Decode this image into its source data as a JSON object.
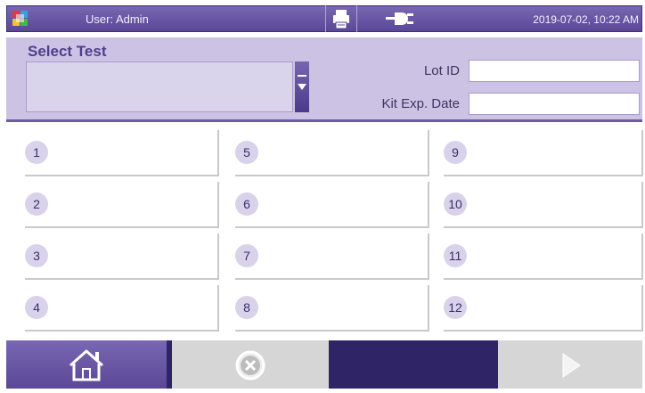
{
  "header": {
    "user": "User: Admin",
    "datetime": "2019-07-02, 10:22 AM"
  },
  "select_panel": {
    "title": "Select Test",
    "lot_label": "Lot ID",
    "lot_value": "",
    "kit_label": "Kit Exp. Date",
    "kit_value": "",
    "selected_test": ""
  },
  "slots": [
    {
      "number": "1"
    },
    {
      "number": "2"
    },
    {
      "number": "3"
    },
    {
      "number": "4"
    },
    {
      "number": "5"
    },
    {
      "number": "6"
    },
    {
      "number": "7"
    },
    {
      "number": "8"
    },
    {
      "number": "9"
    },
    {
      "number": "10"
    },
    {
      "number": "11"
    },
    {
      "number": "12"
    }
  ],
  "bottom": {
    "home_icon": "home-icon",
    "cancel_icon": "close-circle-icon",
    "next_icon": "play-right-icon"
  },
  "colors": {
    "primary": "#5a4796",
    "panel": "#ccc3e4",
    "dark_bar": "#2f2466"
  }
}
